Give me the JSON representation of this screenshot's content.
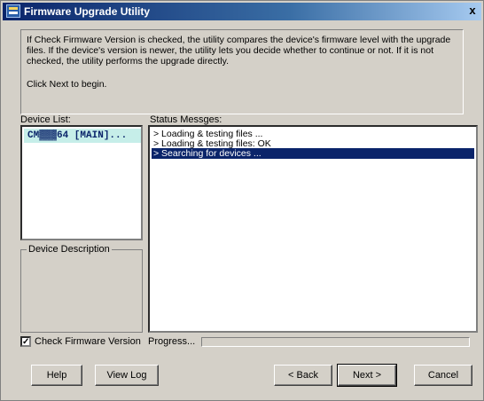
{
  "window": {
    "title": "Firmware Upgrade Utility",
    "close_glyph": "x"
  },
  "intro": {
    "paragraph": "If Check Firmware Version is checked, the utility compares the device's firmware level with the upgrade files. If the device's version is newer, the utility lets you decide whether to continue or not. If it is not checked, the utility performs the upgrade directly.",
    "hint": "Click Next to begin."
  },
  "device_list": {
    "label": "Device List:",
    "items": [
      "CM▓▓▓64 [MAIN]..."
    ]
  },
  "device_description": {
    "label": "Device Description"
  },
  "status": {
    "label": "Status Messges:",
    "messages": [
      "> Loading & testing files ...",
      "> Loading & testing files: OK",
      "> Searching for devices ..."
    ],
    "selected_index": 2
  },
  "options": {
    "check_firmware_label": "Check Firmware Version",
    "check_firmware_checked": true,
    "check_mark": "✓"
  },
  "progress": {
    "label": "Progress...",
    "fraction": 0.0
  },
  "buttons": {
    "help": "Help",
    "view_log": "View Log",
    "back": "< Back",
    "next": "Next >",
    "cancel": "Cancel"
  },
  "colors": {
    "title_bar": "#0a246a",
    "selection": "#0a246a",
    "device_item_bg": "#c6eee9",
    "face": "#d4d0c8"
  },
  "icons": {
    "app": "firmware-utility-icon",
    "close": "close-icon",
    "check": "check-icon"
  }
}
